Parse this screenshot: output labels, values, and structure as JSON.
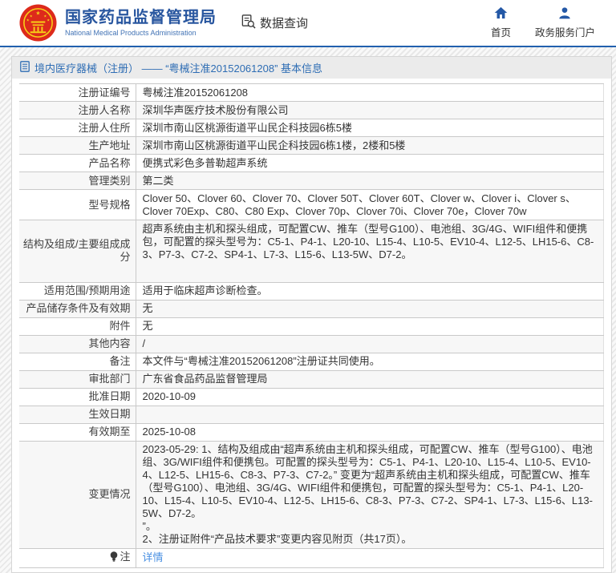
{
  "theme": {
    "accent_blue": "#28569f",
    "header_line_blue": "#2160ae",
    "link_blue": "#4a90e2",
    "crumb_blue": "#2e6db4",
    "emblem_red": "#dd2a1b",
    "emblem_gold": "#f7d117",
    "stripe_gray": "#f7f7f7",
    "border_gray": "#c9c9c9"
  },
  "header": {
    "agency_name_cn": "国家药品监督管理局",
    "agency_name_en": "National Medical Products Administration",
    "data_query_label": "数据查询",
    "nav": [
      {
        "icon": "home-icon",
        "label": "首页"
      },
      {
        "icon": "user-icon",
        "label": "政务服务门户"
      }
    ]
  },
  "breadcrumb": {
    "icon": "document-icon",
    "text": "境内医疗器械（注册） —— “粤械注准20152061208” 基本信息"
  },
  "table": {
    "rows": [
      {
        "label": "注册证编号",
        "value": "粤械注准20152061208"
      },
      {
        "label": "注册人名称",
        "value": "深圳华声医疗技术股份有限公司"
      },
      {
        "label": "注册人住所",
        "value": "深圳市南山区桃源街道平山民企科技园6栋5楼"
      },
      {
        "label": "生产地址",
        "value": "深圳市南山区桃源街道平山民企科技园6栋1楼，2楼和5楼"
      },
      {
        "label": "产品名称",
        "value": "便携式彩色多普勒超声系统"
      },
      {
        "label": "管理类别",
        "value": "第二类"
      },
      {
        "label": "型号规格",
        "value": "Clover 50、Clover 60、Clover 70、Clover 50T、Clover 60T、Clover w、Clover i、Clover s、Clover 70Exp、C80、C80 Exp、Clover 70p、Clover 70i、Clover 70e，Clover 70w"
      },
      {
        "label": "结构及组成/主要组成成分",
        "value": "超声系统由主机和探头组成，可配置CW、推车（型号G100）、电池组、3G/4G、WIFI组件和便携包，可配置的探头型号为：C5-1、P4-1、L20-10、L15-4、L10-5、EV10-4、L12-5、LH15-6、C8-3、P7-3、C7-2、SP4-1、L7-3、L15-6、L13-5W、D7-2。",
        "tall": true
      },
      {
        "label": "适用范围/预期用途",
        "value": "适用于临床超声诊断检查。"
      },
      {
        "label": "产品储存条件及有效期",
        "value": "无"
      },
      {
        "label": "附件",
        "value": "无"
      },
      {
        "label": "其他内容",
        "value": "/"
      },
      {
        "label": "备注",
        "value": "本文件与“粤械注准20152061208”注册证共同使用。"
      },
      {
        "label": "审批部门",
        "value": "广东省食品药品监督管理局"
      },
      {
        "label": "批准日期",
        "value": "2020-10-09"
      },
      {
        "label": "生效日期",
        "value": ""
      },
      {
        "label": "有效期至",
        "value": "2025-10-08"
      },
      {
        "label": "变更情况",
        "value": "2023-05-29: 1、结构及组成由“超声系统由主机和探头组成，可配置CW、推车（型号G100）、电池组、3G/WIFI组件和便携包。可配置的探头型号为：C5-1、P4-1、L20-10、L15-4、L10-5、EV10-4、L12-5、LH15-6、C8-3、P7-3、C7-2。” 变更为“超声系统由主机和探头组成，可配置CW、推车（型号G100）、电池组、3G/4G、WIFI组件和便携包，可配置的探头型号为：C5-1、P4-1、L20-10、L15-4、L10-5、EV10-4、L12-5、LH15-6、C8-3、P7-3、C7-2、SP4-1、L7-3、L15-6、L13-5W、D7-2。\n”。\n2、注册证附件“产品技术要求”变更内容见附页（共17页）。"
      },
      {
        "label": "注",
        "value": "详情",
        "link": true,
        "note_icon": true
      }
    ]
  }
}
